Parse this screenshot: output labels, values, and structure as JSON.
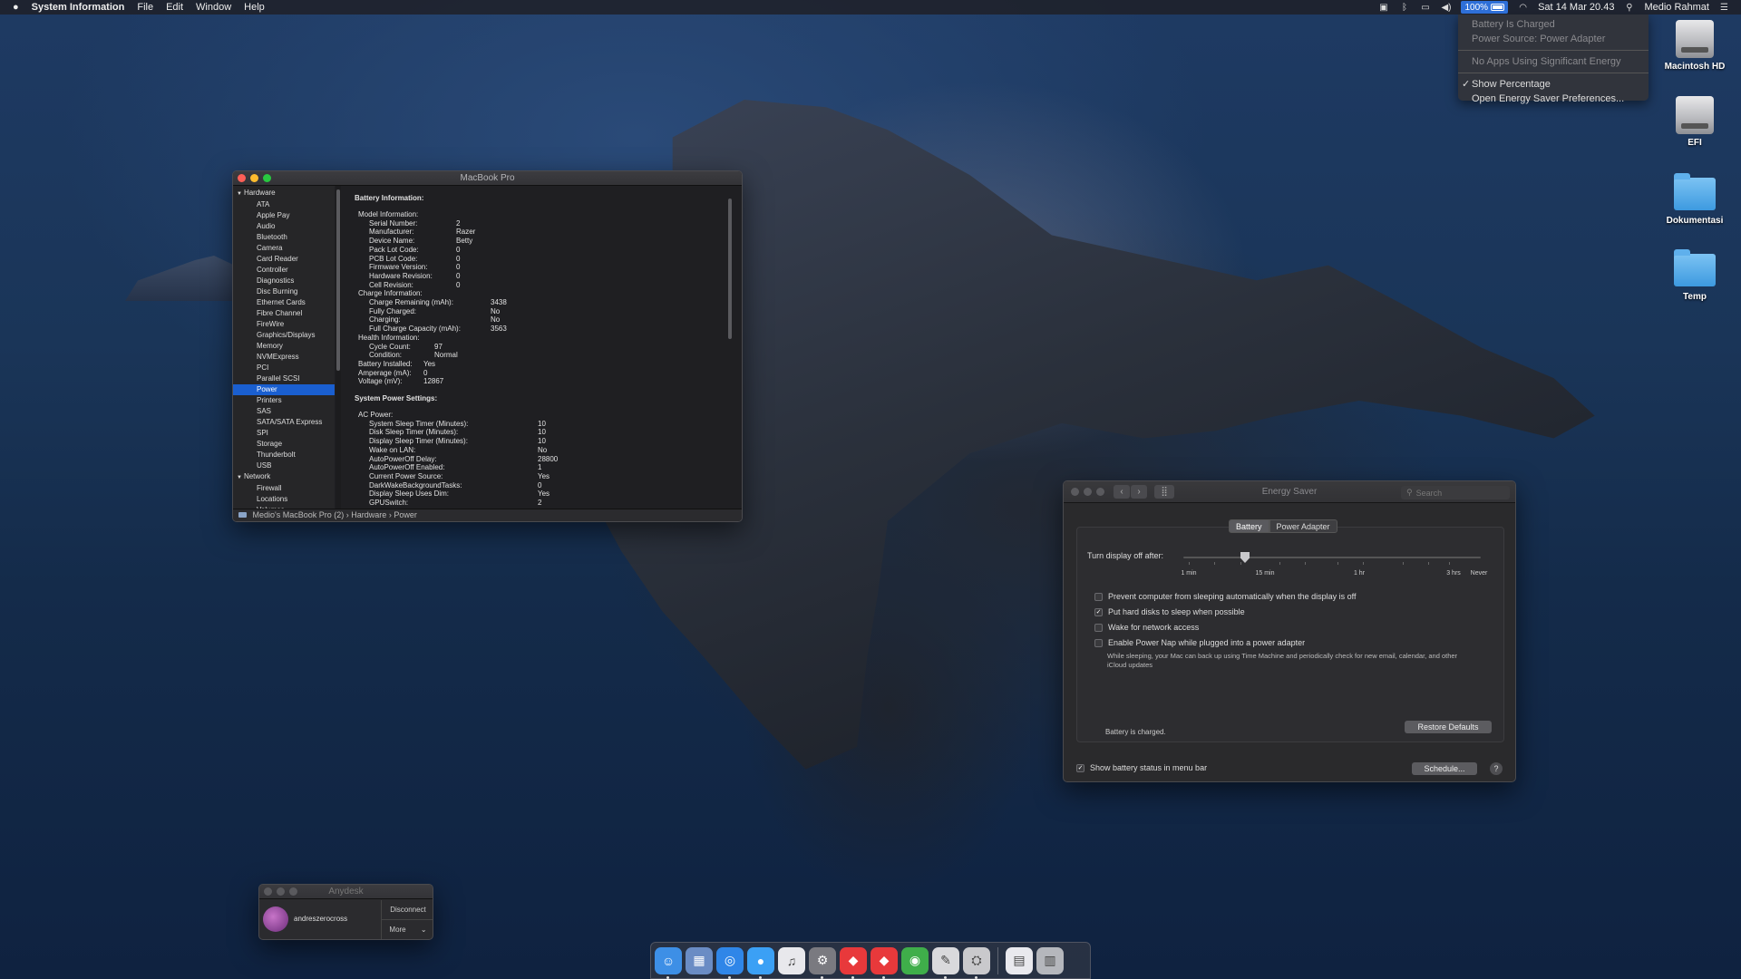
{
  "menubar": {
    "app_name": "System Information",
    "menus": [
      "File",
      "Edit",
      "Window",
      "Help"
    ],
    "battery_percent": "100%",
    "datetime": "Sat 14 Mar  20.43",
    "user": "Medio Rahmat"
  },
  "battery_menu": {
    "status": "Battery Is Charged",
    "power_source": "Power Source: Power Adapter",
    "energy_note": "No Apps Using Significant Energy",
    "show_percentage": "Show Percentage",
    "open_prefs": "Open Energy Saver Preferences..."
  },
  "desktop_icons": [
    {
      "label": "Macintosh HD",
      "icon": "hard-drive-icon"
    },
    {
      "label": "EFI",
      "icon": "hard-drive-icon"
    },
    {
      "label": "Dokumentasi",
      "icon": "folder-icon"
    },
    {
      "label": "Temp",
      "icon": "folder-icon"
    }
  ],
  "sysinfo": {
    "title": "MacBook Pro",
    "sidebar": [
      {
        "label": "Hardware",
        "type": "cat"
      },
      {
        "label": "ATA",
        "type": "sub"
      },
      {
        "label": "Apple Pay",
        "type": "sub"
      },
      {
        "label": "Audio",
        "type": "sub"
      },
      {
        "label": "Bluetooth",
        "type": "sub"
      },
      {
        "label": "Camera",
        "type": "sub"
      },
      {
        "label": "Card Reader",
        "type": "sub"
      },
      {
        "label": "Controller",
        "type": "sub"
      },
      {
        "label": "Diagnostics",
        "type": "sub"
      },
      {
        "label": "Disc Burning",
        "type": "sub"
      },
      {
        "label": "Ethernet Cards",
        "type": "sub"
      },
      {
        "label": "Fibre Channel",
        "type": "sub"
      },
      {
        "label": "FireWire",
        "type": "sub"
      },
      {
        "label": "Graphics/Displays",
        "type": "sub"
      },
      {
        "label": "Memory",
        "type": "sub"
      },
      {
        "label": "NVMExpress",
        "type": "sub"
      },
      {
        "label": "PCI",
        "type": "sub"
      },
      {
        "label": "Parallel SCSI",
        "type": "sub"
      },
      {
        "label": "Power",
        "type": "sub",
        "selected": true
      },
      {
        "label": "Printers",
        "type": "sub"
      },
      {
        "label": "SAS",
        "type": "sub"
      },
      {
        "label": "SATA/SATA Express",
        "type": "sub"
      },
      {
        "label": "SPI",
        "type": "sub"
      },
      {
        "label": "Storage",
        "type": "sub"
      },
      {
        "label": "Thunderbolt",
        "type": "sub"
      },
      {
        "label": "USB",
        "type": "sub"
      },
      {
        "label": "Network",
        "type": "cat"
      },
      {
        "label": "Firewall",
        "type": "sub"
      },
      {
        "label": "Locations",
        "type": "sub"
      },
      {
        "label": "Volumes",
        "type": "sub"
      }
    ],
    "content": [
      {
        "kind": "h",
        "text": "Battery Information:"
      },
      {
        "kind": "row",
        "indent": 1,
        "key": "Model Information:",
        "val": ""
      },
      {
        "kind": "row",
        "indent": 2,
        "key": "Serial Number:",
        "val": "2"
      },
      {
        "kind": "row",
        "indent": 2,
        "key": "Manufacturer:",
        "val": "Razer"
      },
      {
        "kind": "row",
        "indent": 2,
        "key": "Device Name:",
        "val": "Betty"
      },
      {
        "kind": "row",
        "indent": 2,
        "key": "Pack Lot Code:",
        "val": "0"
      },
      {
        "kind": "row",
        "indent": 2,
        "key": "PCB Lot Code:",
        "val": "0"
      },
      {
        "kind": "row",
        "indent": 2,
        "key": "Firmware Version:",
        "val": "0"
      },
      {
        "kind": "row",
        "indent": 2,
        "key": "Hardware Revision:",
        "val": "0"
      },
      {
        "kind": "row",
        "indent": 2,
        "key": "Cell Revision:",
        "val": "0"
      },
      {
        "kind": "row",
        "indent": 1,
        "key": "Charge Information:",
        "val": ""
      },
      {
        "kind": "row",
        "indent": 2,
        "key": "Charge Remaining (mAh):",
        "val": "3438",
        "col": "b"
      },
      {
        "kind": "row",
        "indent": 2,
        "key": "Fully Charged:",
        "val": "No",
        "col": "b"
      },
      {
        "kind": "row",
        "indent": 2,
        "key": "Charging:",
        "val": "No",
        "col": "b"
      },
      {
        "kind": "row",
        "indent": 2,
        "key": "Full Charge Capacity (mAh):",
        "val": "3563",
        "col": "b"
      },
      {
        "kind": "row",
        "indent": 1,
        "key": "Health Information:",
        "val": ""
      },
      {
        "kind": "row",
        "indent": 2,
        "key": "Cycle Count:",
        "val": "97",
        "col": "c"
      },
      {
        "kind": "row",
        "indent": 2,
        "key": "Condition:",
        "val": "Normal",
        "col": "c"
      },
      {
        "kind": "row",
        "indent": 1,
        "key": "Battery Installed:",
        "val": "Yes",
        "col": "c"
      },
      {
        "kind": "row",
        "indent": 1,
        "key": "Amperage (mA):",
        "val": "0",
        "col": "c"
      },
      {
        "kind": "row",
        "indent": 1,
        "key": "Voltage (mV):",
        "val": "12867",
        "col": "c"
      },
      {
        "kind": "gap"
      },
      {
        "kind": "h",
        "text": "System Power Settings:"
      },
      {
        "kind": "row",
        "indent": 1,
        "key": "AC Power:",
        "val": ""
      },
      {
        "kind": "row",
        "indent": 2,
        "key": "System Sleep Timer (Minutes):",
        "val": "10",
        "col": "d"
      },
      {
        "kind": "row",
        "indent": 2,
        "key": "Disk Sleep Timer (Minutes):",
        "val": "10",
        "col": "d"
      },
      {
        "kind": "row",
        "indent": 2,
        "key": "Display Sleep Timer (Minutes):",
        "val": "10",
        "col": "d"
      },
      {
        "kind": "row",
        "indent": 2,
        "key": "Wake on LAN:",
        "val": "No",
        "col": "d"
      },
      {
        "kind": "row",
        "indent": 2,
        "key": "AutoPowerOff Delay:",
        "val": "28800",
        "col": "d"
      },
      {
        "kind": "row",
        "indent": 2,
        "key": "AutoPowerOff Enabled:",
        "val": "1",
        "col": "d"
      },
      {
        "kind": "row",
        "indent": 2,
        "key": "Current Power Source:",
        "val": "Yes",
        "col": "d"
      },
      {
        "kind": "row",
        "indent": 2,
        "key": "DarkWakeBackgroundTasks:",
        "val": "0",
        "col": "d"
      },
      {
        "kind": "row",
        "indent": 2,
        "key": "Display Sleep Uses Dim:",
        "val": "Yes",
        "col": "d"
      },
      {
        "kind": "row",
        "indent": 2,
        "key": "GPUSwitch:",
        "val": "2",
        "col": "d"
      }
    ],
    "path": [
      "Medio's MacBook Pro (2)",
      "Hardware",
      "Power"
    ]
  },
  "energy": {
    "title": "Energy Saver",
    "search_placeholder": "Search",
    "tabs": [
      "Battery",
      "Power Adapter"
    ],
    "slider_label": "Turn display off after:",
    "slider_value": "10 min",
    "ticks": [
      "1 min",
      "15 min",
      "1 hr",
      "3 hrs",
      "Never"
    ],
    "checkboxes": [
      {
        "label": "Prevent computer from sleeping automatically when the display is off",
        "checked": false
      },
      {
        "label": "Put hard disks to sleep when possible",
        "checked": true
      },
      {
        "label": "Wake for network access",
        "checked": false
      },
      {
        "label": "Enable Power Nap while plugged into a power adapter",
        "checked": false
      }
    ],
    "power_nap_note": "While sleeping, your Mac can back up using Time Machine and periodically check for new email, calendar, and other iCloud updates",
    "status": "Battery is charged.",
    "restore_defaults": "Restore Defaults",
    "show_battery_status": "Show battery status in menu bar",
    "schedule": "Schedule...",
    "help": "?"
  },
  "anydesk": {
    "title": "Anydesk",
    "user": "andreszerocross",
    "disconnect": "Disconnect",
    "more": "More"
  },
  "dock": {
    "apps": [
      {
        "name": "finder-icon",
        "color": "#3d8fe6"
      },
      {
        "name": "preview-icon",
        "color": "#6a8cc4"
      },
      {
        "name": "safari-icon",
        "color": "#2f86e8"
      },
      {
        "name": "messages-icon",
        "color": "#3ba0f5"
      },
      {
        "name": "itunes-icon",
        "color": "#e8e8ec"
      },
      {
        "name": "system-preferences-icon",
        "color": "#7a7a80"
      },
      {
        "name": "anydesk-icon",
        "color": "#e8393b"
      },
      {
        "name": "anydesk-alt-icon",
        "color": "#e8393b"
      },
      {
        "name": "globe-icon",
        "color": "#3fae4a"
      },
      {
        "name": "script-editor-icon",
        "color": "#d9d9dc"
      },
      {
        "name": "system-information-icon",
        "color": "#c9c9cc"
      },
      {
        "name": "document-icon",
        "color": "#e9e9ee"
      },
      {
        "name": "trash-icon",
        "color": "#b5b7bc"
      }
    ]
  }
}
